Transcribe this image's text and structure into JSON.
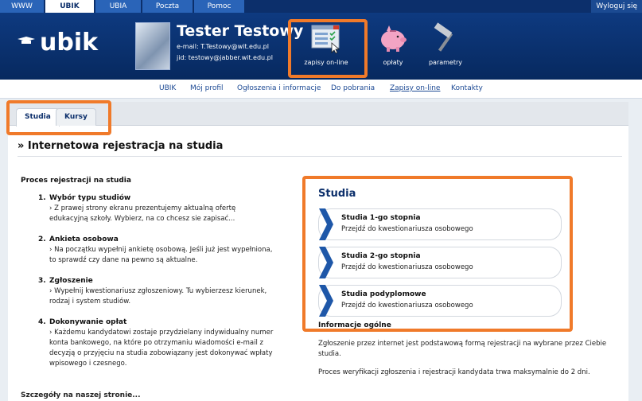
{
  "top_tabs": [
    {
      "label": "WWW"
    },
    {
      "label": "UBIK"
    },
    {
      "label": "UBIA"
    },
    {
      "label": "Poczta"
    },
    {
      "label": "Pomoc"
    }
  ],
  "logout_label": "Wyloguj się",
  "logo_text": "ubik",
  "user": {
    "name": "Tester Testowy",
    "email": "e-mail: T.Testowy@wit.edu.pl",
    "jid": "jid: testowy@jabber.wit.edu.pl"
  },
  "header_icons": [
    {
      "label": "zapisy on-line",
      "icon": "form-window-icon"
    },
    {
      "label": "opłaty",
      "icon": "piggy-bank-icon"
    },
    {
      "label": "parametry",
      "icon": "hammer-icon"
    }
  ],
  "nav": [
    {
      "label": "UBIK"
    },
    {
      "label": "Mój profil"
    },
    {
      "label": "Ogłoszenia i informacje"
    },
    {
      "label": "Do pobrania"
    },
    {
      "label": "Zapisy on-line"
    },
    {
      "label": "Kontakty"
    }
  ],
  "tabs": [
    {
      "label": "Studia"
    },
    {
      "label": "Kursy"
    }
  ],
  "page_title": "» Internetowa rejestracja na studia",
  "process": {
    "heading": "Proces rejestracji na studia",
    "steps": [
      {
        "num": "1.",
        "title": "Wybór typu studiów",
        "desc": "› Z prawej strony ekranu prezentujemy aktualną ofertę edukacyjną szkoły. Wybierz, na co chcesz sie zapisać..."
      },
      {
        "num": "2.",
        "title": "Ankieta osobowa",
        "desc": "› Na początku wypełnij ankietę osobową. Jeśli już jest wypełniona, to sprawdź czy dane na pewno są aktualne."
      },
      {
        "num": "3.",
        "title": "Zgłoszenie",
        "desc": "› Wypełnij kwestionariusz zgłoszeniowy. Tu wybierzesz kierunek, rodzaj i system studiów."
      },
      {
        "num": "4.",
        "title": "Dokonywanie opłat",
        "desc": "› Każdemu kandydatowi zostaje przydzielany indywidualny numer konta bankowego, na które po otrzymaniu wiadomości e-mail z decyzją o przyjęciu na studia zobowiązany jest dokonywać wpłaty wpisowego i czesnego."
      }
    ],
    "footer_partial": "Szczegóły na naszej stronie..."
  },
  "studia": {
    "heading": "Studia",
    "items": [
      {
        "title": "Studia 1-go stopnia",
        "sub": "Przejdź do kwestionariusza osobowego"
      },
      {
        "title": "Studia 2-go stopnia",
        "sub": "Przejdź do kwestionariusza osobowego"
      },
      {
        "title": "Studia podyplomowe",
        "sub": "Przejdź do kwestionariusza osobowego"
      }
    ],
    "info_heading": "Informacje ogólne",
    "info_paragraphs": [
      "Zgłoszenie przez internet jest podstawową formą rejestracji na wybrane przez Ciebie studia.",
      "Proces weryfikacji zgłoszenia i rejestracji kandydata trwa maksymalnie do 2 dni."
    ]
  },
  "colors": {
    "header_blue": "#0e3a80",
    "highlight_orange": "#f07a2a",
    "link_blue": "#1d4a94"
  }
}
